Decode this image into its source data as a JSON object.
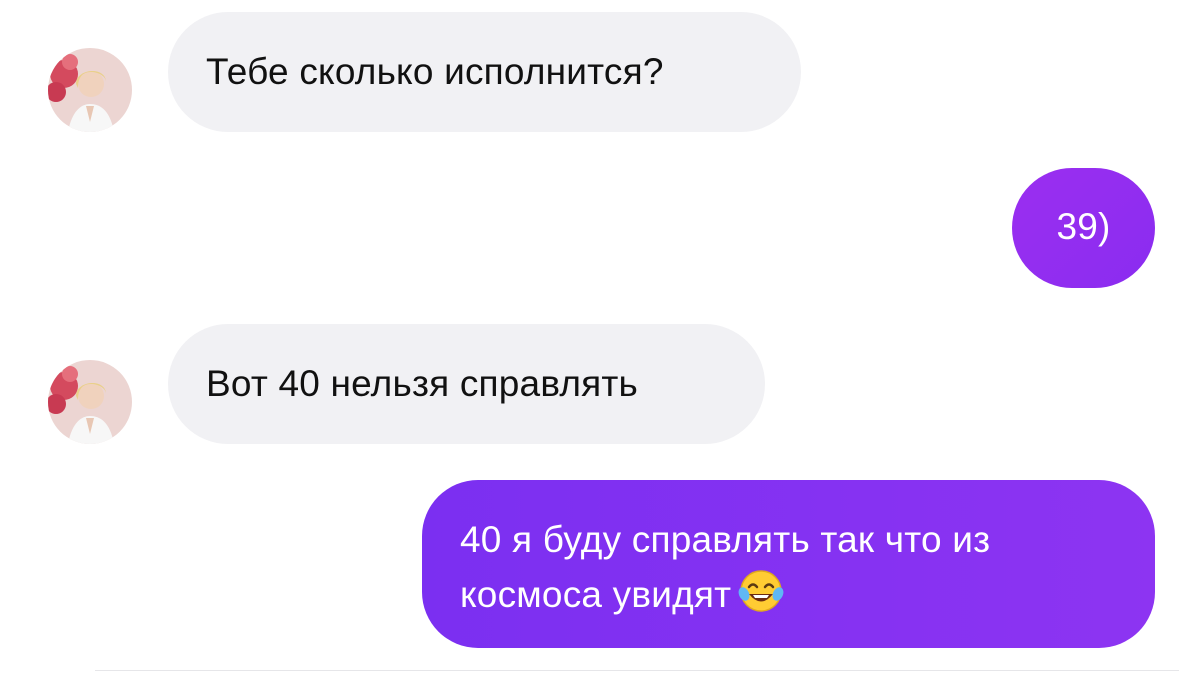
{
  "chat": {
    "messages": [
      {
        "id": "m1",
        "side": "incoming",
        "text": "Тебе сколько исполнится?"
      },
      {
        "id": "m2",
        "side": "outgoing",
        "text": "39)"
      },
      {
        "id": "m3",
        "side": "incoming",
        "text": "Вот 40 нельзя справлять"
      },
      {
        "id": "m4",
        "side": "outgoing",
        "line1": "40 я буду справлять так что из",
        "line2": "космоса увидят",
        "emoji": "face-with-tears-of-joy-icon"
      }
    ]
  },
  "colors": {
    "incoming_bubble": "#f1f1f4",
    "outgoing_bubble": "#8a2cf0",
    "incoming_text": "#111111",
    "outgoing_text": "#ffffff"
  }
}
